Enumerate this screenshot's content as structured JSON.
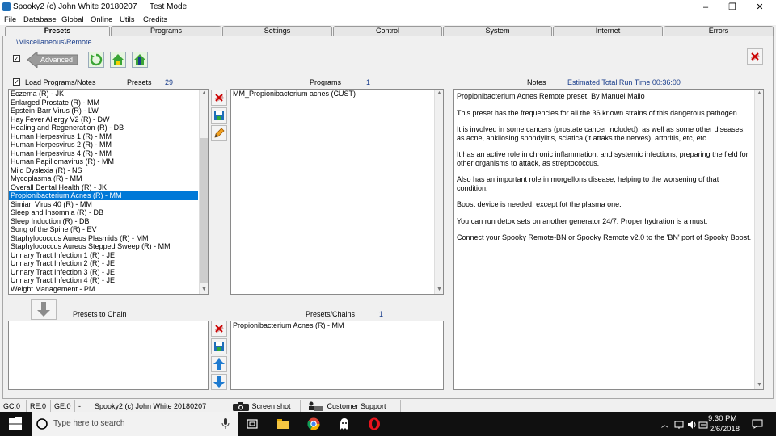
{
  "titlebar": {
    "title": "Spooky2 (c) John White 20180207",
    "mode": "Test Mode",
    "minimize": "–",
    "restore": "❐",
    "close": "✕"
  },
  "menu": [
    "File",
    "Database",
    "Global",
    "Online",
    "Utils",
    "Credits"
  ],
  "tabs": [
    "Presets",
    "Programs",
    "Settings",
    "Control",
    "System",
    "Internet",
    "Errors"
  ],
  "breadcrumb": "\\Miscellaneous\\Remote",
  "advanced_label": "Advanced",
  "load_programs_label": "Load Programs/Notes",
  "presets_label": "Presets",
  "presets_count": "29",
  "programs_label": "Programs",
  "programs_count": "1",
  "notes_label": "Notes",
  "estimated_run_time": "Estimated Total Run Time 00:36:00",
  "presets_list": [
    "Eczema (R) - JK",
    "Enlarged Prostate (R) - MM",
    "Epstein-Barr Virus (R) - LW",
    "Hay Fever Allergy V2 (R) - DW",
    "Healing and Regeneration (R) - DB",
    "Human Herpesvirus 1 (R) - MM",
    "Human Herpesvirus 2 (R) - MM",
    "Human Herpesvirus 4 (R) - MM",
    "Human Papillomavirus (R) - MM",
    "Mild Dyslexia (R) - NS",
    "Mycoplasma (R) - MM",
    "Overall Dental Health (R) - JK",
    "Propionibacterium Acnes (R) - MM",
    "Simian Virus 40 (R) - MM",
    "Sleep and Insomnia (R) - DB",
    "Sleep Induction (R) - DB",
    "Song of the Spine (R) - EV",
    "Staphylococcus Aureus Plasmids (R) - MM",
    "Staphylococcus Aureus Stepped Sweep (R) - MM",
    "Urinary Tract Infection 1 (R) - JE",
    "Urinary Tract Infection 2 (R) - JE",
    "Urinary Tract Infection 3 (R) - JE",
    "Urinary Tract Infection 4 (R) - JE",
    "Weight Management - PM"
  ],
  "selected_preset_index": 12,
  "programs_list": [
    "MM_Propionibacterium acnes (CUST)"
  ],
  "notes": [
    "Propionibacterium Acnes Remote preset. By Manuel Mallo",
    "This preset has the frequencies for all the 36 known strains of this dangerous pathogen.",
    "It is involved in some cancers (prostate cancer included), as well as some other diseases, as acne, ankilosing spondylitis, sciatica (it attaks the nerves), arthritis, etc, etc.",
    "It has an active role in chronic inflammation, and systemic infections, preparing the field for other organisms to attack, as streptococcus.",
    "Also has an important role in morgellons disease, helping to the worsening of that condition.",
    "Boost device is needed, except fot the plasma one.",
    "You can run detox sets on another generator 24/7. Proper hydration is a must.",
    "Connect your Spooky Remote-BN or Spooky Remote v2.0 to the 'BN' port of Spooky Boost."
  ],
  "presets_to_chain_label": "Presets to Chain",
  "presets_chains_label": "Presets/Chains",
  "presets_chains_count": "1",
  "presets_chains_list": [
    "Propionibacterium Acnes (R) - MM"
  ],
  "status": {
    "gc": "GC:0",
    "re": "RE:0",
    "ge": "GE:0",
    "dash": "-",
    "app": "Spooky2 (c) John White 20180207",
    "screenshot": "Screen shot",
    "support": "Customer Support"
  },
  "taskbar": {
    "search_placeholder": "Type here to search",
    "time": "9:30 PM",
    "date": "2/6/2018"
  },
  "colors": {
    "selection": "#0078d7",
    "label_blue": "#1a3e8c",
    "taskbar": "#101010"
  }
}
